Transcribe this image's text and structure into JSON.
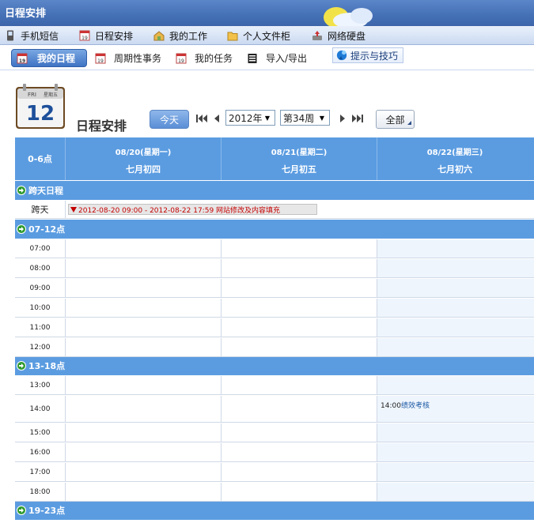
{
  "app": {
    "title": "日程安排"
  },
  "main_menu": [
    {
      "label": "手机短信",
      "icon": "phone-icon"
    },
    {
      "label": "日程安排",
      "icon": "calendar-icon"
    },
    {
      "label": "我的工作",
      "icon": "work-icon"
    },
    {
      "label": "个人文件柜",
      "icon": "folder-icon"
    },
    {
      "label": "网络硬盘",
      "icon": "disk-icon"
    }
  ],
  "sub_tabs": [
    {
      "label": "我的日程",
      "active": true
    },
    {
      "label": "周期性事务",
      "active": false
    },
    {
      "label": "我的任务",
      "active": false
    },
    {
      "label": "导入/导出",
      "active": false
    }
  ],
  "tips": {
    "label": "提示与技巧"
  },
  "calendar_icon": {
    "day_abbr": "FRI",
    "weekday": "星期五",
    "date": "12"
  },
  "toolbar": {
    "page_title": "日程安排",
    "today_label": "今天",
    "year_select": "2012年",
    "week_select": "第34周",
    "filter_label": "全部"
  },
  "grid": {
    "corner_label": "0-6点",
    "days": [
      {
        "date": "08/20(星期一)",
        "lunar": "七月初四"
      },
      {
        "date": "08/21(星期二)",
        "lunar": "七月初五"
      },
      {
        "date": "08/22(星期三)",
        "lunar": "七月初六"
      }
    ],
    "cross_day": {
      "section_label": "跨天日程",
      "row_label": "跨天",
      "event": "2012-08-20 09:00 - 2012-08-22 17:59 网站修改及内容填充"
    },
    "sections": [
      {
        "label": "07-12点",
        "hours": [
          "07:00",
          "08:00",
          "09:00",
          "10:00",
          "11:00",
          "12:00"
        ]
      },
      {
        "label": "13-18点",
        "hours": [
          "13:00",
          "14:00",
          "15:00",
          "16:00",
          "17:00",
          "18:00"
        ]
      },
      {
        "label": "19-23点",
        "hours": []
      }
    ],
    "events": [
      {
        "time": "14:00",
        "title": "绩效考核",
        "day": "08/22(星期三)",
        "hour": "14:00"
      }
    ]
  },
  "colors": {
    "header_blue": "#5b9ce1",
    "event_red": "#c40000",
    "link_blue": "#1d5aa5"
  }
}
